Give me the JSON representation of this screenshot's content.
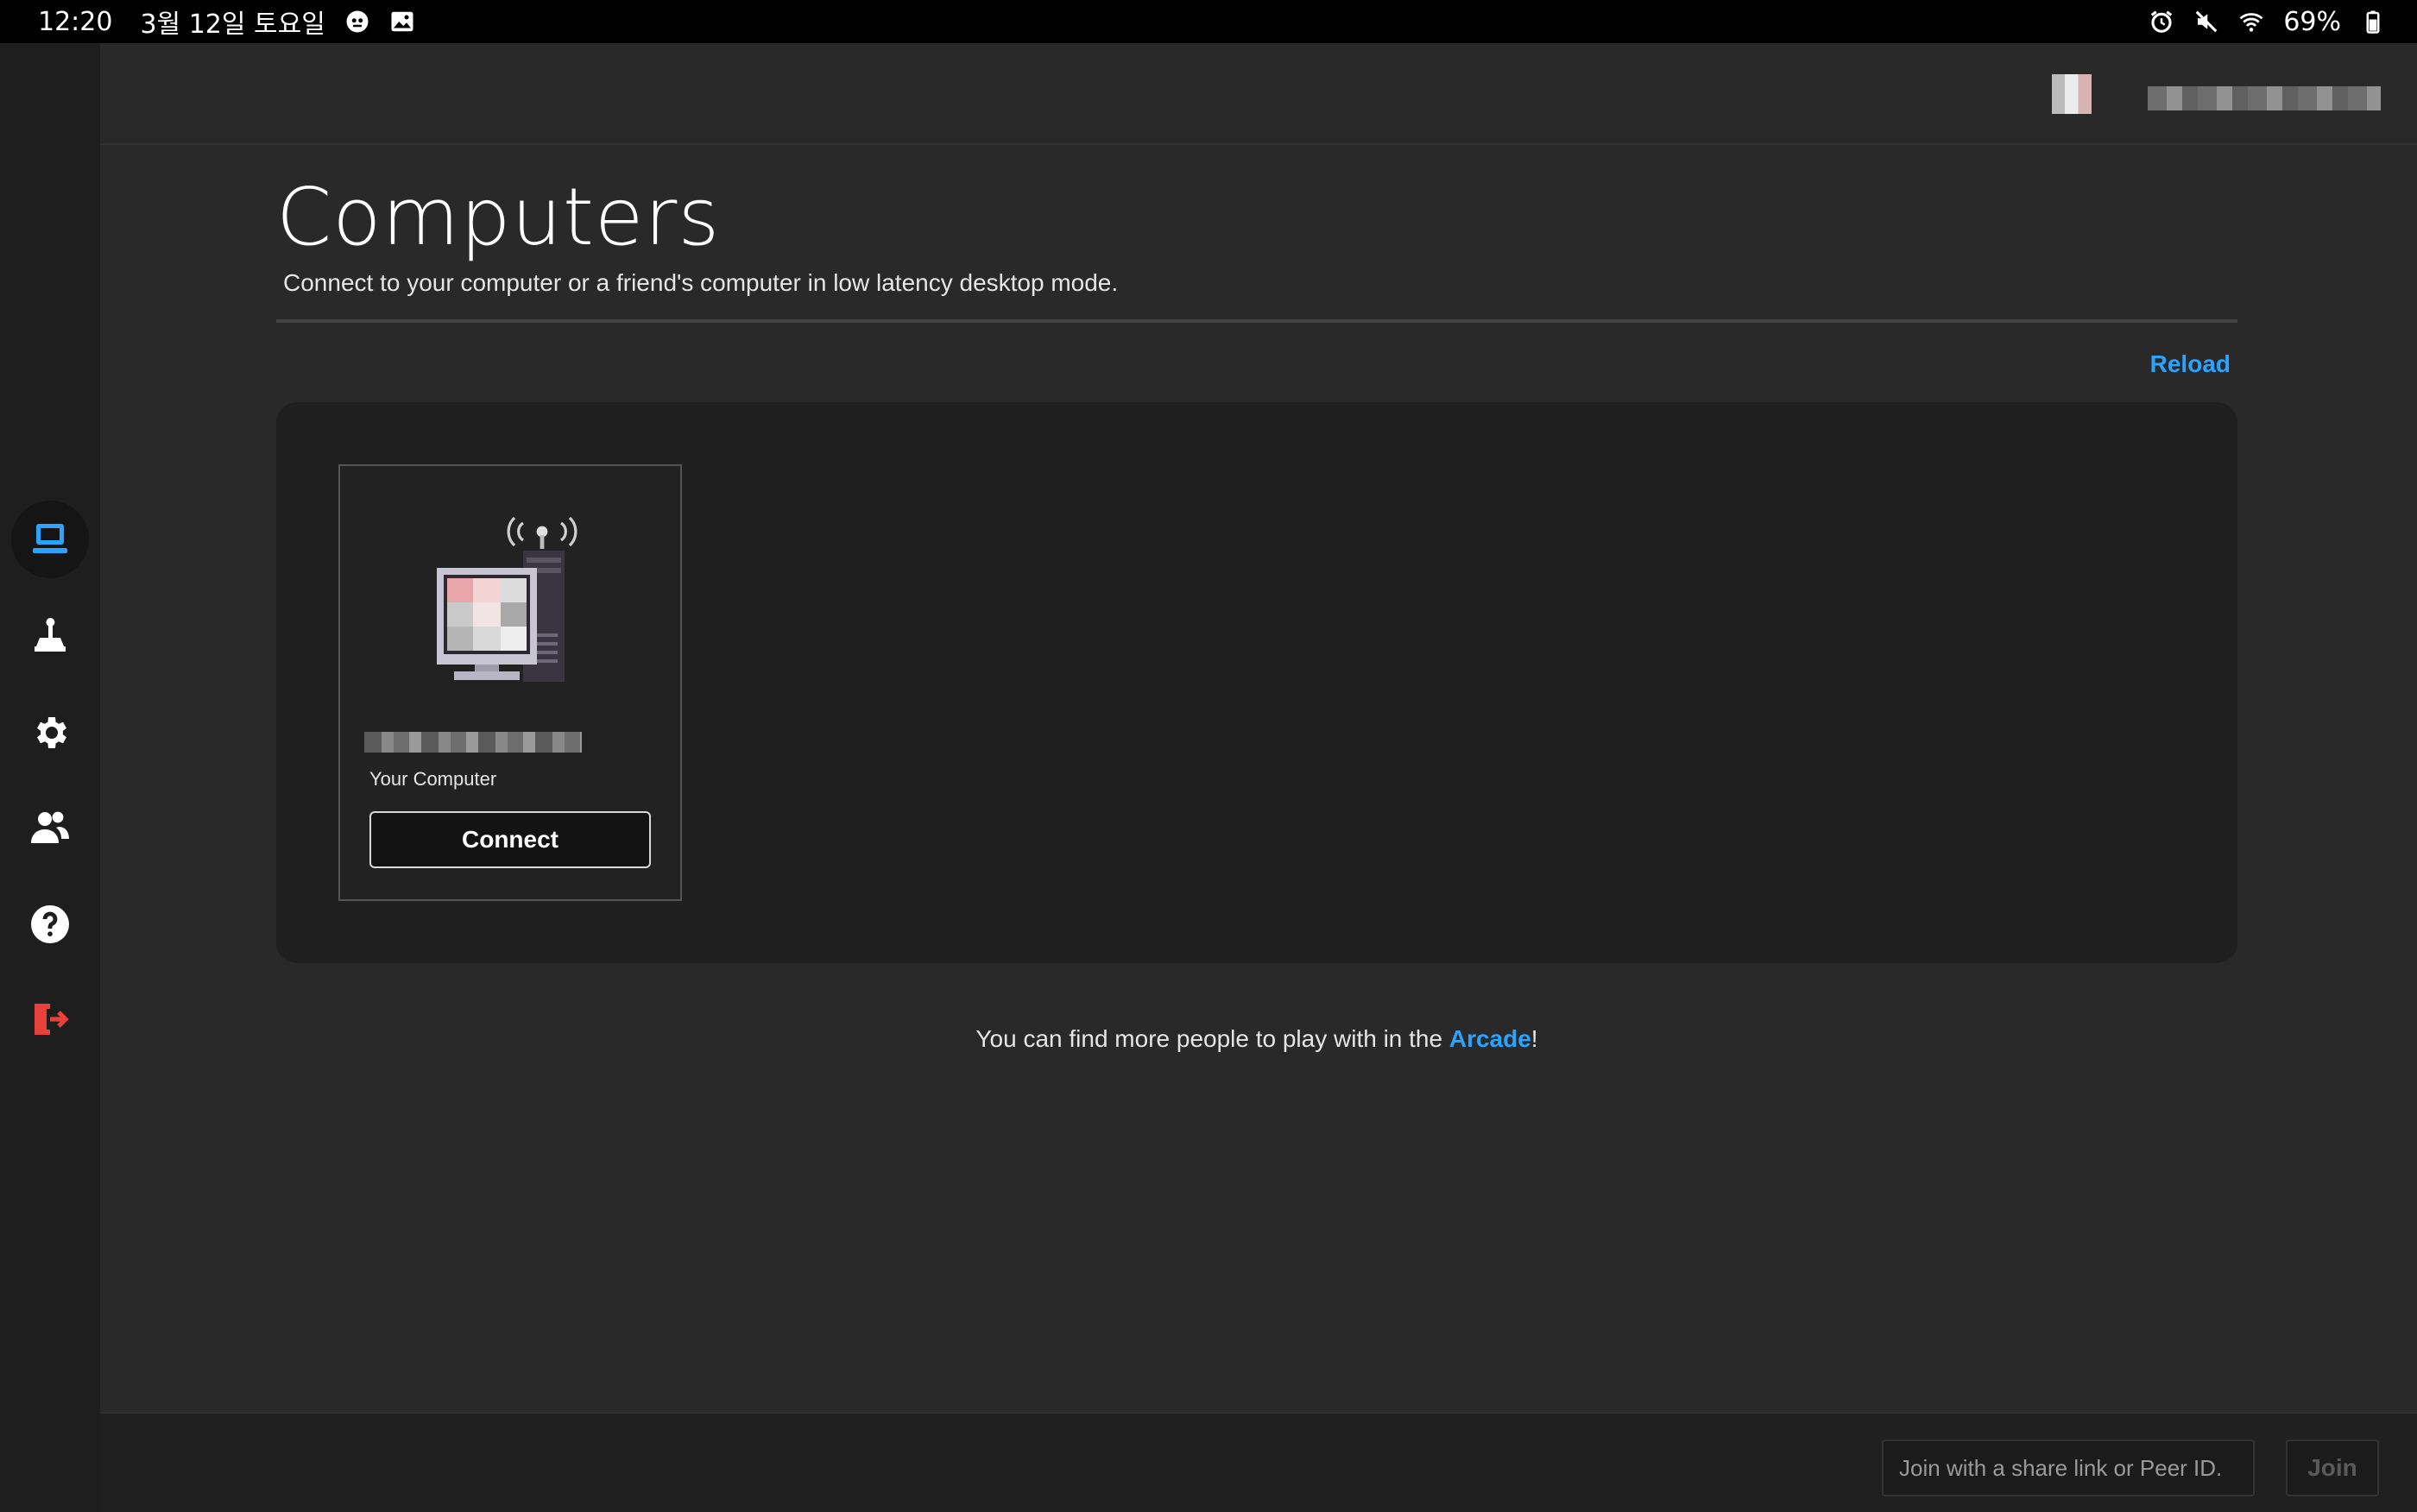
{
  "status_bar": {
    "time": "12:20",
    "date": "3월 12일 토요일",
    "battery": "69%",
    "left_icons": [
      "app-notification-icon",
      "gallery-icon"
    ],
    "right_icons": [
      "alarm-icon",
      "mute-icon",
      "wifi-icon",
      "battery-icon"
    ]
  },
  "rail": {
    "items": [
      {
        "name": "computers",
        "icon": "computer-icon",
        "active": true
      },
      {
        "name": "arcade",
        "icon": "joystick-icon",
        "active": false
      },
      {
        "name": "settings",
        "icon": "gear-icon",
        "active": false
      },
      {
        "name": "friends",
        "icon": "people-icon",
        "active": false
      },
      {
        "name": "help",
        "icon": "help-icon",
        "active": false
      },
      {
        "name": "logout",
        "icon": "logout-icon",
        "active": false
      }
    ]
  },
  "page": {
    "title": "Computers",
    "subtitle": "Connect to your computer or a friend's computer in low latency desktop mode.",
    "reload_label": "Reload"
  },
  "computer_card": {
    "label": "Your Computer",
    "connect_label": "Connect"
  },
  "arcade_note": {
    "prefix": "You can find more people to play with in the ",
    "link": "Arcade",
    "suffix": "!"
  },
  "join_bar": {
    "placeholder": "Join with a share link or Peer ID.",
    "join_label": "Join"
  },
  "colors": {
    "accent": "#2ba3ff",
    "logout": "#e8403a",
    "background": "#292929",
    "panel": "#1f1f1f",
    "rail": "#1e1e1e"
  }
}
